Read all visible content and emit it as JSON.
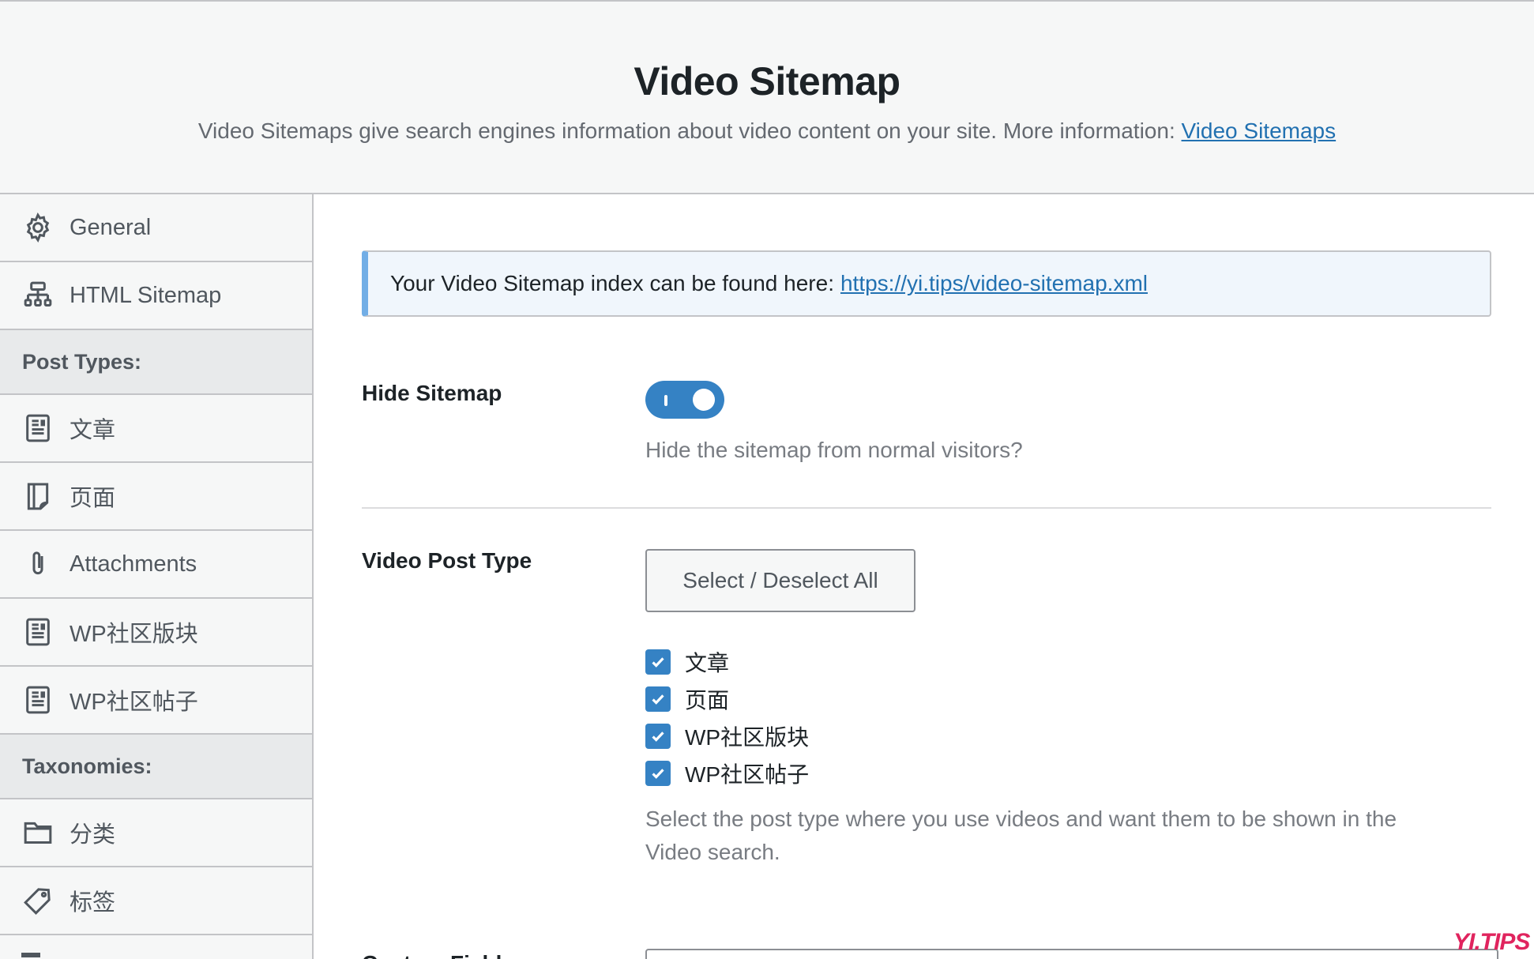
{
  "header": {
    "title": "Video Sitemap",
    "description": "Video Sitemaps give search engines information about video content on your site. More information:",
    "link_label": "Video Sitemaps"
  },
  "sidebar": {
    "items_top": [
      {
        "label": "General",
        "icon": "gear-icon"
      },
      {
        "label": "HTML Sitemap",
        "icon": "sitemap-icon"
      }
    ],
    "post_types_heading": "Post Types:",
    "post_types": [
      {
        "label": "文章",
        "icon": "post-icon"
      },
      {
        "label": "页面",
        "icon": "page-icon"
      },
      {
        "label": "Attachments",
        "icon": "paperclip-icon"
      },
      {
        "label": "WP社区版块",
        "icon": "post-icon"
      },
      {
        "label": "WP社区帖子",
        "icon": "post-icon"
      }
    ],
    "taxonomies_heading": "Taxonomies:",
    "taxonomies": [
      {
        "label": "分类",
        "icon": "folder-icon"
      },
      {
        "label": "标签",
        "icon": "tag-icon"
      }
    ]
  },
  "main": {
    "notice_text": "Your Video Sitemap index can be found here:",
    "notice_link": "https://yi.tips/video-sitemap.xml",
    "hide_sitemap": {
      "label": "Hide Sitemap",
      "enabled": true,
      "help": "Hide the sitemap from normal visitors?"
    },
    "video_post_type": {
      "label": "Video Post Type",
      "button_label": "Select / Deselect All",
      "options": [
        {
          "label": "文章",
          "checked": true
        },
        {
          "label": "页面",
          "checked": true
        },
        {
          "label": "WP社区版块",
          "checked": true
        },
        {
          "label": "WP社区帖子",
          "checked": true
        }
      ],
      "help_line1": "Select the post type where you use videos and want them to be shown in the",
      "help_line2": "Video search."
    },
    "next_label": "Custom Fields"
  },
  "watermark": "YI.TIPS",
  "colors": {
    "accent": "#3582c4",
    "link": "#2271b1",
    "notice_border": "#72aee6"
  }
}
